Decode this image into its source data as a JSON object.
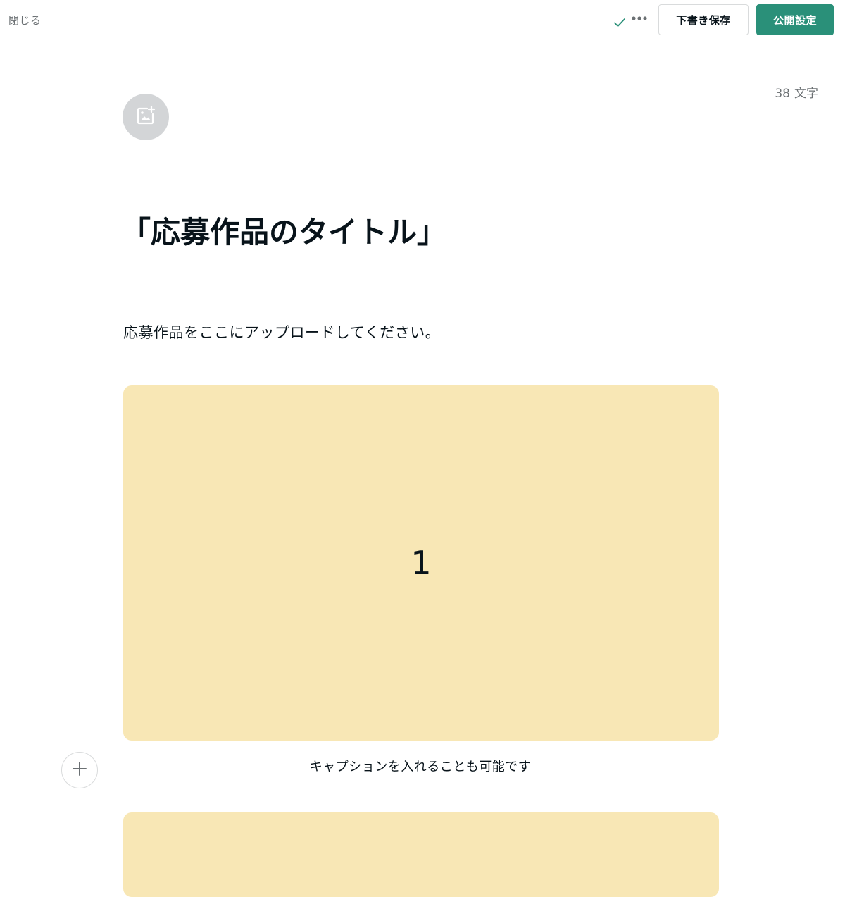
{
  "header": {
    "close_label": "閉じる",
    "saved_icon": "check-icon",
    "more_icon": "more-dots-icon",
    "draft_save_label": "下書き保存",
    "publish_settings_label": "公開設定"
  },
  "editor": {
    "char_count_value": "38",
    "char_count_unit": "文字",
    "add_image_icon": "add-image-icon",
    "title": "「応募作品のタイトル」",
    "body_text": "応募作品をここにアップロードしてください。",
    "image_blocks": [
      {
        "label": "1",
        "caption": "キャプションを入れることも可能です"
      },
      {
        "label": ""
      }
    ],
    "insert_block_icon": "plus-icon"
  },
  "colors": {
    "accent_green": "#2a9079",
    "image_placeholder": "#f8e7b5",
    "text_main": "#08131a",
    "text_muted": "#6b7073"
  }
}
